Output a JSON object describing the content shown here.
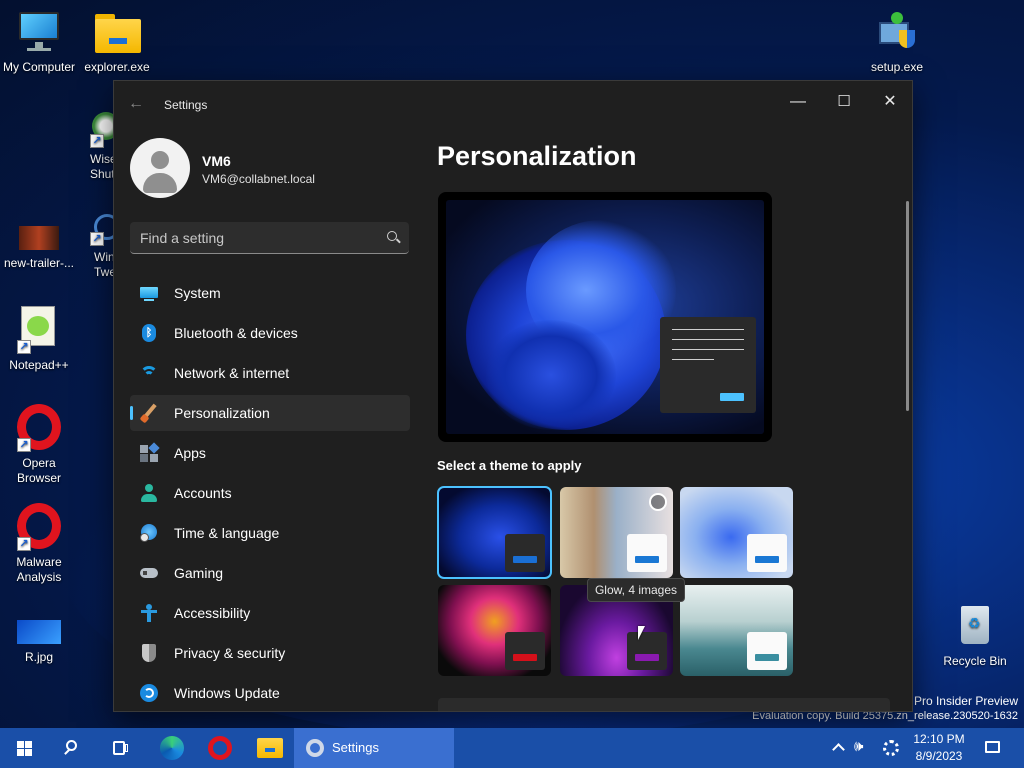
{
  "desktop": {
    "icons": [
      {
        "label": "My Computer",
        "icon": "monitor-icon"
      },
      {
        "label": "explorer.exe",
        "icon": "folder-icon"
      },
      {
        "label": "setup.exe",
        "icon": "installer-icon"
      },
      {
        "label_line1": "Wise",
        "label_line2": "Shut",
        "icon": "wise-shutdown-icon"
      },
      {
        "label": "new-trailer-...",
        "icon": "video-thumbnail-icon"
      },
      {
        "label_line1": "Win",
        "label_line2": "Twe",
        "icon": "windows-tweaker-icon"
      },
      {
        "label": "Notepad++",
        "icon": "notepad-plus-plus-icon"
      },
      {
        "label_line1": "Opera",
        "label_line2": "Browser",
        "icon": "opera-icon"
      },
      {
        "label_line1": "Malware",
        "label_line2": "Analysis",
        "icon": "opera-icon"
      },
      {
        "label": "R.jpg",
        "icon": "image-file-icon"
      },
      {
        "label": "Recycle Bin",
        "icon": "recycle-bin-icon"
      }
    ],
    "watermark_line1": "Pro Insider Preview",
    "watermark_line2": "Evaluation copy. Build 25375.zn_release.230520-1632"
  },
  "window": {
    "title": "Settings",
    "controls": {
      "minimize": "—",
      "maximize": "☐",
      "close": "✕"
    }
  },
  "profile": {
    "name": "VM6",
    "email": "VM6@collabnet.local"
  },
  "search": {
    "placeholder": "Find a setting"
  },
  "nav": {
    "items": [
      {
        "label": "System",
        "icon": "system-icon"
      },
      {
        "label": "Bluetooth & devices",
        "icon": "bluetooth-icon"
      },
      {
        "label": "Network & internet",
        "icon": "wifi-icon"
      },
      {
        "label": "Personalization",
        "icon": "brush-icon",
        "active": true
      },
      {
        "label": "Apps",
        "icon": "apps-icon"
      },
      {
        "label": "Accounts",
        "icon": "accounts-icon"
      },
      {
        "label": "Time & language",
        "icon": "time-language-icon"
      },
      {
        "label": "Gaming",
        "icon": "gamepad-icon"
      },
      {
        "label": "Accessibility",
        "icon": "accessibility-icon"
      },
      {
        "label": "Privacy & security",
        "icon": "shield-icon"
      },
      {
        "label": "Windows Update",
        "icon": "update-icon"
      }
    ]
  },
  "content": {
    "title": "Personalization",
    "themes_label": "Select a theme to apply",
    "tooltip": "Glow, 4 images",
    "themes": [
      {
        "name": "windows-dark",
        "accent": "#1a6fd4",
        "selected": true
      },
      {
        "name": "spotlight",
        "accent": "#1a78d4"
      },
      {
        "name": "windows-light",
        "accent": "#1a78d4"
      },
      {
        "name": "captured-motion",
        "accent": "#d4101a"
      },
      {
        "name": "glow",
        "accent": "#8a1ab0"
      },
      {
        "name": "flow",
        "accent": "#3a8ea0"
      }
    ]
  },
  "taskbar": {
    "items": [
      "start-icon",
      "search-icon",
      "task-view-icon",
      "edge-icon",
      "opera-icon",
      "file-explorer-icon"
    ],
    "active_app": "Settings",
    "time": "12:10 PM",
    "date": "8/9/2023"
  },
  "colors": {
    "accent": "#4cc2ff",
    "window_bg": "#1f1f1f",
    "taskbar": "#1a4fa8"
  }
}
